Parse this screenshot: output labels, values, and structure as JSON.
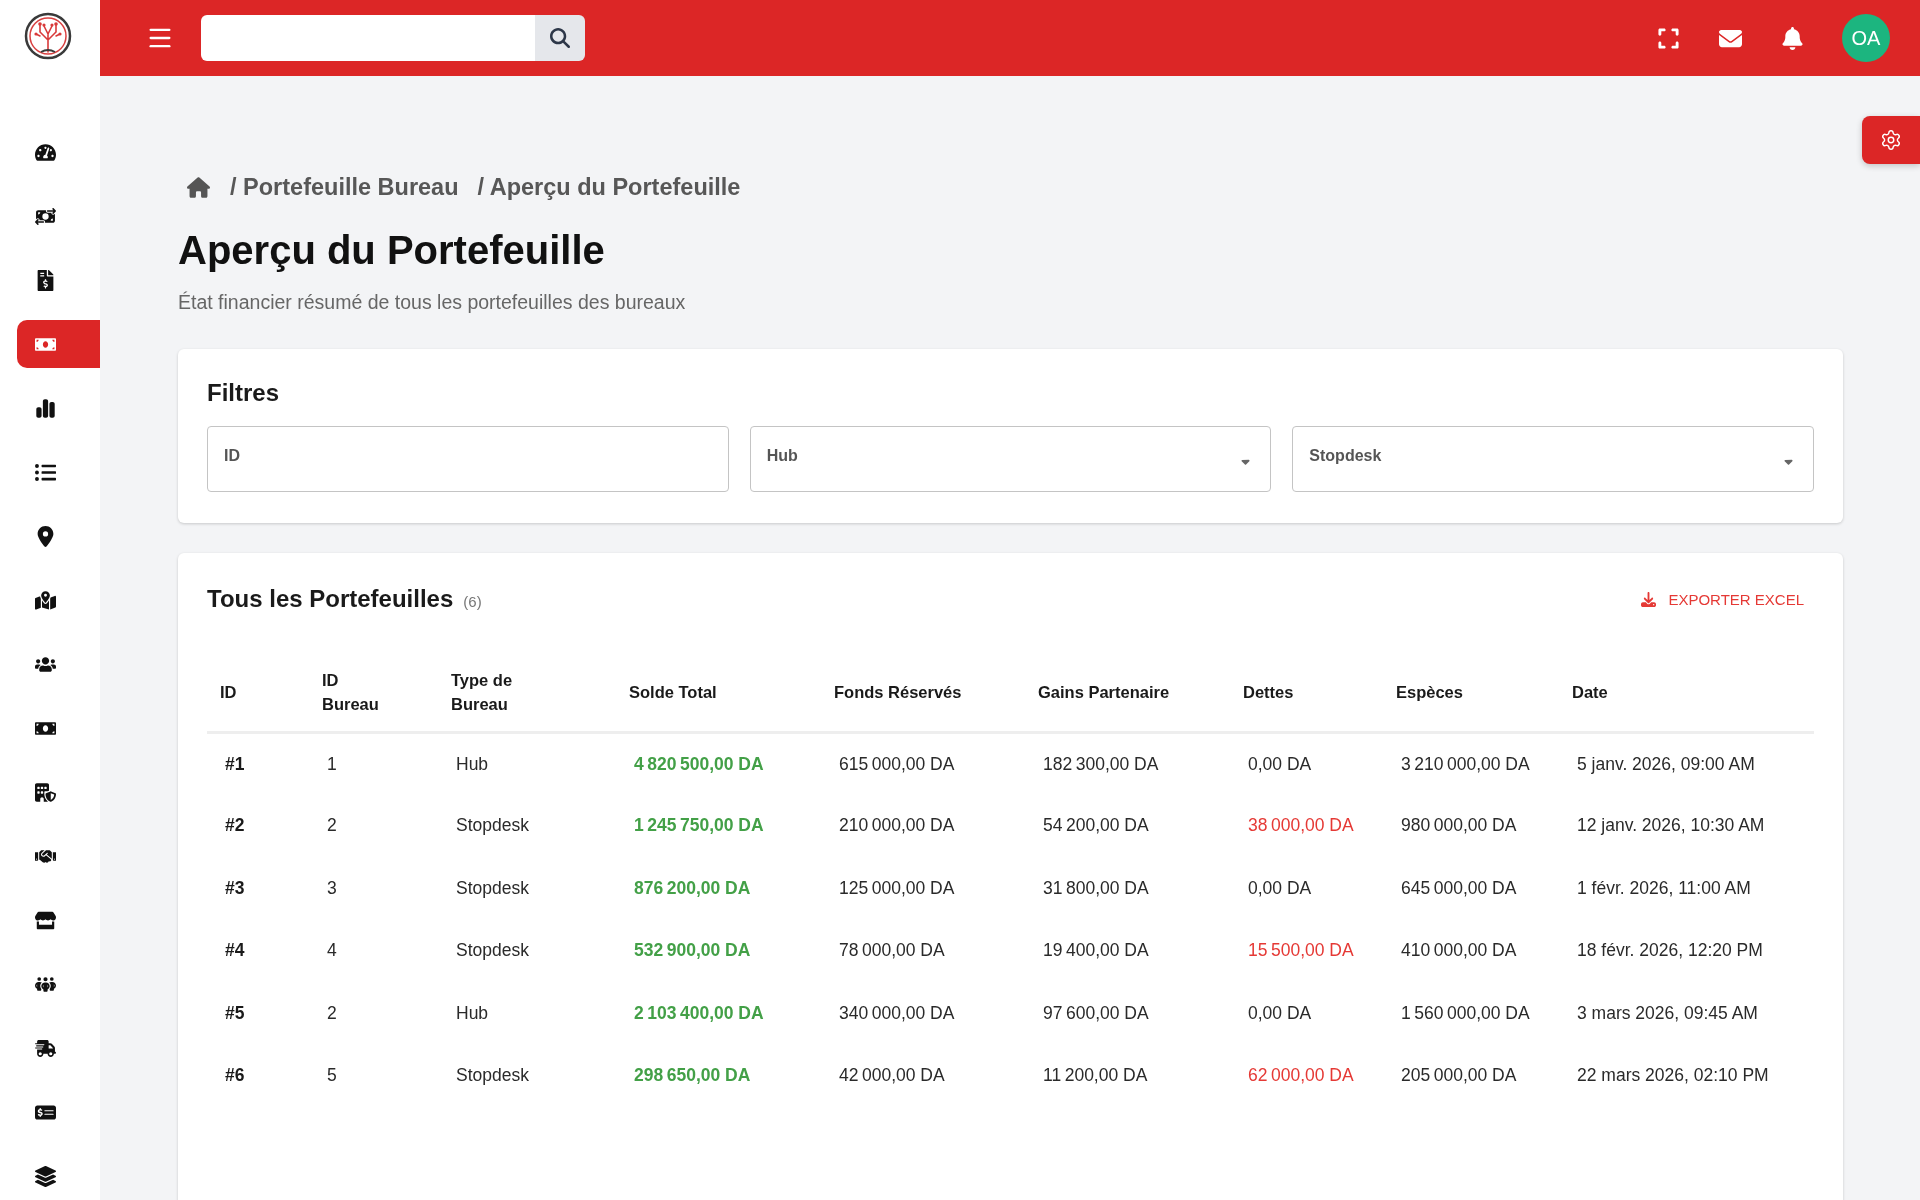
{
  "sidebar": {
    "items": [
      {
        "selected": false
      },
      {
        "selected": false
      },
      {
        "selected": false
      },
      {
        "selected": true
      },
      {
        "selected": false
      },
      {
        "selected": false
      },
      {
        "selected": false
      },
      {
        "selected": false
      },
      {
        "selected": false
      },
      {
        "selected": false
      },
      {
        "selected": false
      },
      {
        "selected": false
      },
      {
        "selected": false
      },
      {
        "selected": false
      },
      {
        "selected": false
      },
      {
        "selected": false
      },
      {
        "selected": false
      }
    ]
  },
  "top_bar": {
    "avatar": {
      "initials": "OA"
    }
  },
  "breadcrumb": [
    "/ Portefeuille Bureau",
    "/ Aperçu du Portefeuille"
  ],
  "page": {
    "title": "Aperçu du Portefeuille",
    "subtitle": "État financier résumé de tous les portefeuilles des bureaux"
  },
  "filters": {
    "title": "Filtres",
    "fields": [
      {
        "kind": "text",
        "placeholder": "ID"
      },
      {
        "kind": "select",
        "placeholder": "Hub"
      },
      {
        "kind": "select",
        "placeholder": "Stopdesk"
      }
    ]
  },
  "wallets": {
    "title": "Tous les Portefeuilles",
    "count": "(6)",
    "export_button": "EXPORTER EXCEL",
    "columns": [
      "ID",
      "ID Bureau",
      "Type de Bureau",
      "Solde Total",
      "Fonds Réservés",
      "Gains Partenaire",
      "Dettes",
      "Espèces",
      "Date"
    ],
    "rows": [
      {
        "id": "#1",
        "bureau_id": "1",
        "bureau_type": "Hub",
        "solde_total": "4 820 500,00 DA",
        "fonds_reserves": "615 000,00 DA",
        "gains_partenaire": "182 300,00 DA",
        "dettes": "0,00 DA",
        "in_debt": false,
        "especes": "3 210 000,00 DA",
        "date": "5 janv. 2026, 09:00 AM"
      },
      {
        "id": "#2",
        "bureau_id": "2",
        "bureau_type": "Stopdesk",
        "solde_total": "1 245 750,00 DA",
        "fonds_reserves": "210 000,00 DA",
        "gains_partenaire": "54 200,00 DA",
        "dettes": "38 000,00 DA",
        "in_debt": true,
        "especes": "980 000,00 DA",
        "date": "12 janv. 2026, 10:30 AM"
      },
      {
        "id": "#3",
        "bureau_id": "3",
        "bureau_type": "Stopdesk",
        "solde_total": "876 200,00 DA",
        "fonds_reserves": "125 000,00 DA",
        "gains_partenaire": "31 800,00 DA",
        "dettes": "0,00 DA",
        "in_debt": false,
        "especes": "645 000,00 DA",
        "date": "1 févr. 2026, 11:00 AM"
      },
      {
        "id": "#4",
        "bureau_id": "4",
        "bureau_type": "Stopdesk",
        "solde_total": "532 900,00 DA",
        "fonds_reserves": "78 000,00 DA",
        "gains_partenaire": "19 400,00 DA",
        "dettes": "15 500,00 DA",
        "in_debt": true,
        "especes": "410 000,00 DA",
        "date": "18 févr. 2026, 12:20 PM"
      },
      {
        "id": "#5",
        "bureau_id": "2",
        "bureau_type": "Hub",
        "solde_total": "2 103 400,00 DA",
        "fonds_reserves": "340 000,00 DA",
        "gains_partenaire": "97 600,00 DA",
        "dettes": "0,00 DA",
        "in_debt": false,
        "especes": "1 560 000,00 DA",
        "date": "3 mars 2026, 09:45 AM"
      },
      {
        "id": "#6",
        "bureau_id": "5",
        "bureau_type": "Stopdesk",
        "solde_total": "298 650,00 DA",
        "fonds_reserves": "42 000,00 DA",
        "gains_partenaire": "11 200,00 DA",
        "dettes": "62 000,00 DA",
        "in_debt": true,
        "especes": "205 000,00 DA",
        "date": "22 mars 2026, 02:10 PM"
      }
    ]
  }
}
